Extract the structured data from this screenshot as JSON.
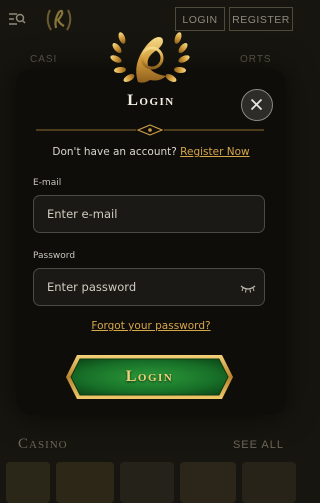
{
  "header": {
    "menu_icon": "menu-search-icon",
    "logo_icon": "laurel-logo-icon",
    "login_label": "LOGIN",
    "register_label": "REGISTER"
  },
  "background": {
    "nav_left": "CASI",
    "nav_right": "ORTS",
    "section_title": "Casino",
    "see_all": "SEE ALL"
  },
  "modal": {
    "crest_icon": "laurel-crest-icon",
    "title": "Login",
    "close_icon": "close-icon",
    "no_account_text": "Don't have an account?",
    "register_link": "Register Now",
    "email": {
      "label": "E-mail",
      "placeholder": "Enter e-mail",
      "value": ""
    },
    "password": {
      "label": "Password",
      "placeholder": "Enter password",
      "value": "",
      "toggle_icon": "eye-closed-icon"
    },
    "forgot_link": "Forgot your password?",
    "submit_label": "Login"
  },
  "colors": {
    "background": "#16150f",
    "modal": "#0e0d0a",
    "gold": "#d6a64a",
    "button_green": "#1f7a2b"
  }
}
